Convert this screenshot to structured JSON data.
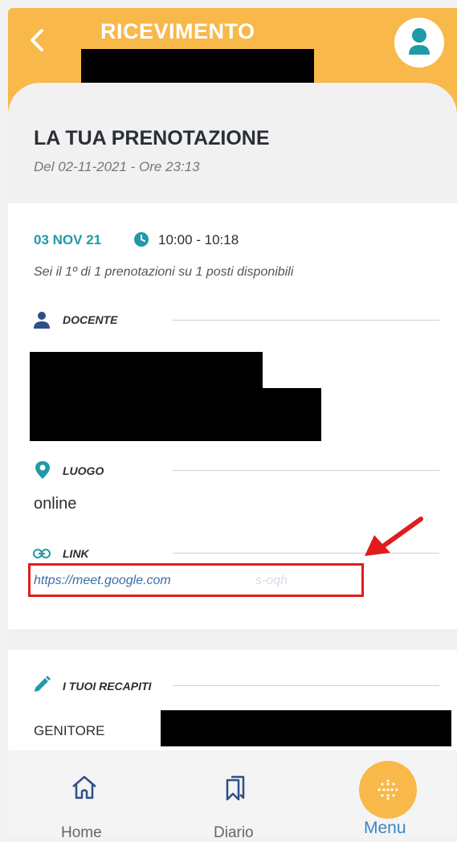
{
  "header": {
    "title": "RICEVIMENTO"
  },
  "booking": {
    "heading": "LA TUA PRENOTAZIONE",
    "created": "Del 02-11-2021  -  Ore 23:13",
    "date": "03 NOV 21",
    "time": "10:00 - 10:18",
    "position_note": "Sei il 1º di 1 prenotazioni su 1 posti disponibili"
  },
  "sections": {
    "docente_label": "DOCENTE",
    "luogo_label": "LUOGO",
    "luogo_value": "online",
    "link_label": "LINK",
    "link_value": "https://meet.google.com",
    "link_suffix": "s-oqh",
    "recapiti_label": "I TUOI RECAPITI",
    "genitore_label": "GENITORE"
  },
  "nav": {
    "home": "Home",
    "diario": "Diario",
    "menu": "Menu"
  },
  "colors": {
    "accent": "#f8b84a",
    "teal": "#1f9aa6",
    "highlight": "#e21c1c"
  }
}
